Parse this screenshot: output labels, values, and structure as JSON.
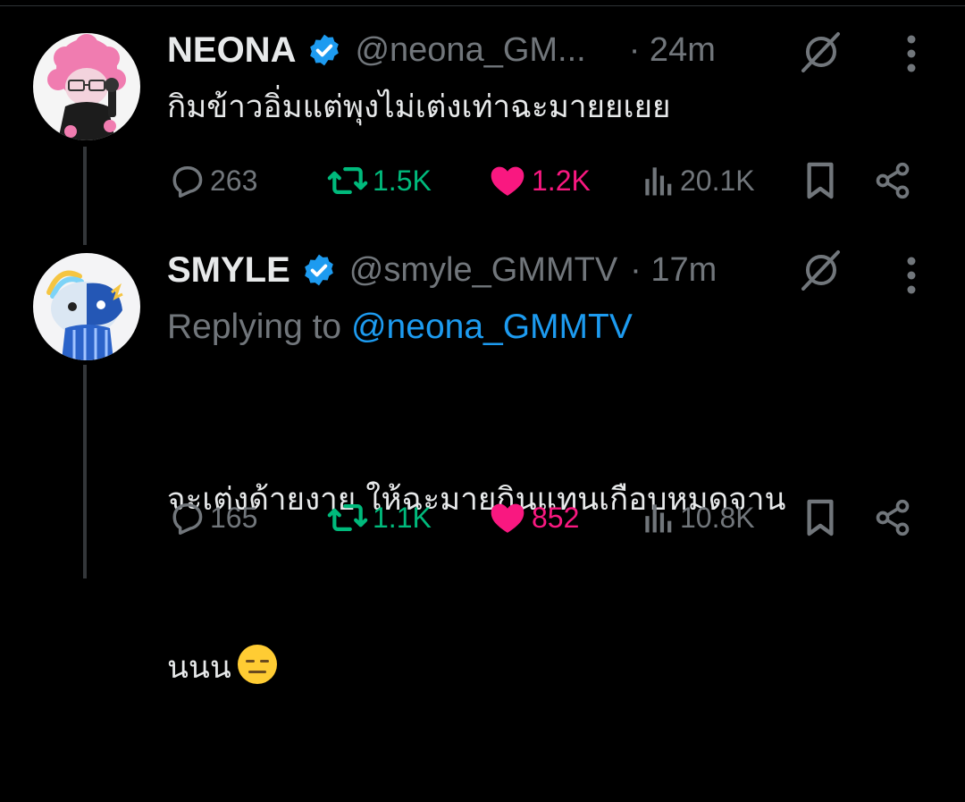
{
  "tweets": [
    {
      "name": "NEONA",
      "handle": "@neona_GM...",
      "time": "· 24m",
      "text": "กิมข้าวอิ่มแต่พุงไม่เต่งเท่าฉะมายยเยย",
      "stats": {
        "replies": "263",
        "retweets": "1.5K",
        "likes": "1.2K",
        "views": "20.1K"
      },
      "avatar_icon": "pink-haired-doll-avatar"
    },
    {
      "name": "SMYLE",
      "handle": "@smyle_GMMTV",
      "time": "· 17m",
      "replying_prefix": "Replying to",
      "replying_handle": "@neona_GMMTV",
      "text_line1": "จะเต่งด้ายงาย ให้ฉะมายกินแทนเกือบหมดจาน",
      "text_line2": "นนน",
      "emoji": "expressionless-face-emoji",
      "stats": {
        "replies": "165",
        "retweets": "1.1K",
        "likes": "852",
        "views": "10.8K"
      },
      "avatar_icon": "blue-mascot-avatar"
    }
  ],
  "icons": {
    "verified": "verified-badge-icon",
    "grok": "grok-icon",
    "more": "more-dots-icon",
    "reply": "reply-icon",
    "retweet": "retweet-icon",
    "like": "heart-icon",
    "views": "views-icon",
    "bookmark": "bookmark-icon",
    "share": "share-icon"
  },
  "colors": {
    "background": "#000000",
    "text": "#e7e9ea",
    "muted": "#71767b",
    "accent": "#1d9bf0",
    "retweet": "#00ba7c",
    "like": "#f91880"
  }
}
